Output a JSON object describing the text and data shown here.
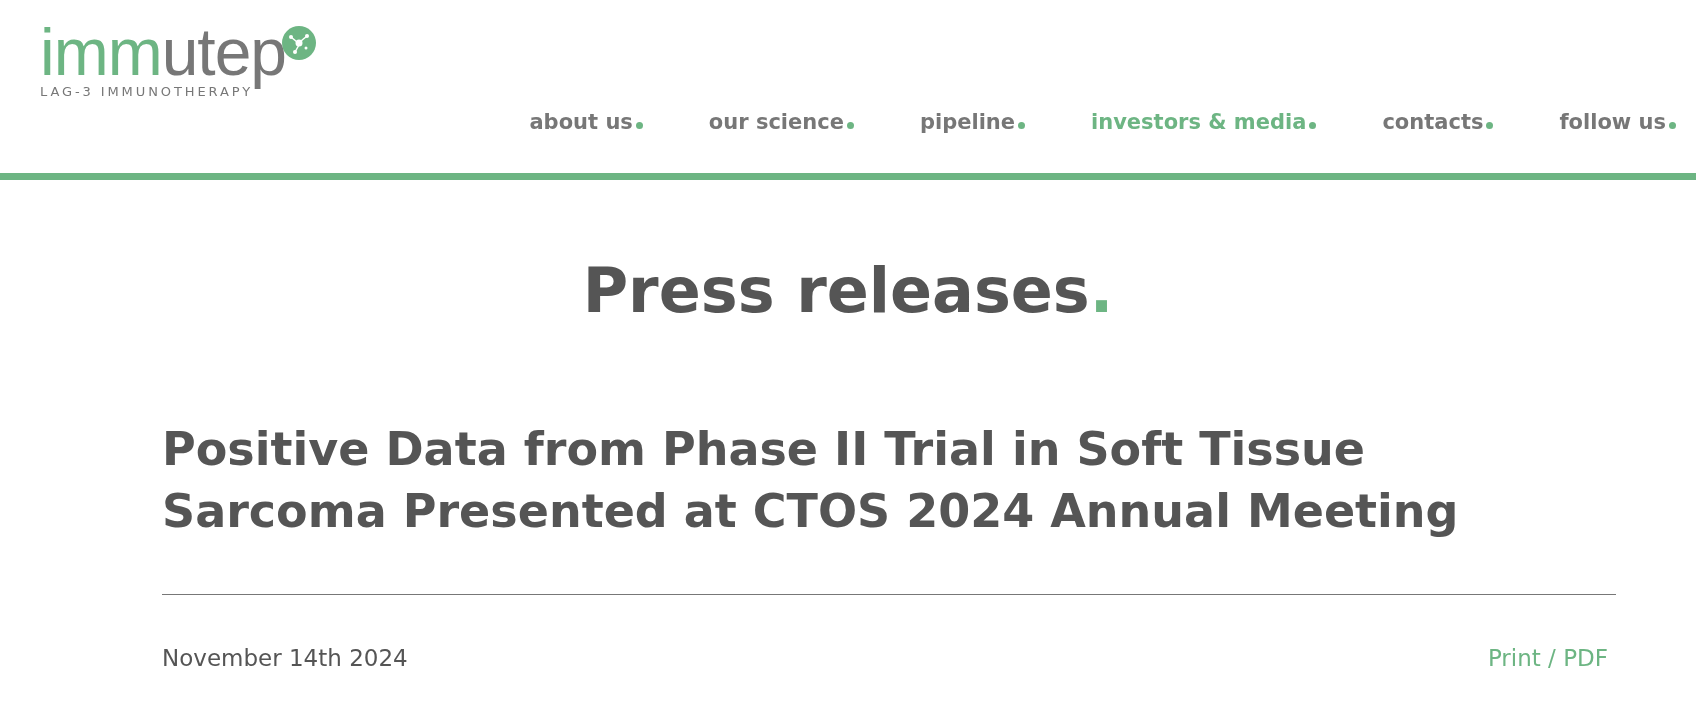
{
  "logo": {
    "primary": "imm",
    "secondary": "utep",
    "tagline": "LAG-3 IMMUNOTHERAPY"
  },
  "nav": [
    {
      "label": "about us",
      "selected": false
    },
    {
      "label": "our science",
      "selected": false
    },
    {
      "label": "pipeline",
      "selected": false
    },
    {
      "label": "investors & media",
      "selected": true
    },
    {
      "label": "contacts",
      "selected": false
    },
    {
      "label": "follow us",
      "selected": false
    }
  ],
  "page_title": {
    "text": "Press releases",
    "dot": "."
  },
  "article": {
    "title": "Positive Data from Phase II Trial in Soft Tissue Sarcoma Presented at CTOS 2024 Annual Meeting",
    "date": "November 14th 2024",
    "print_link": "Print / PDF"
  }
}
